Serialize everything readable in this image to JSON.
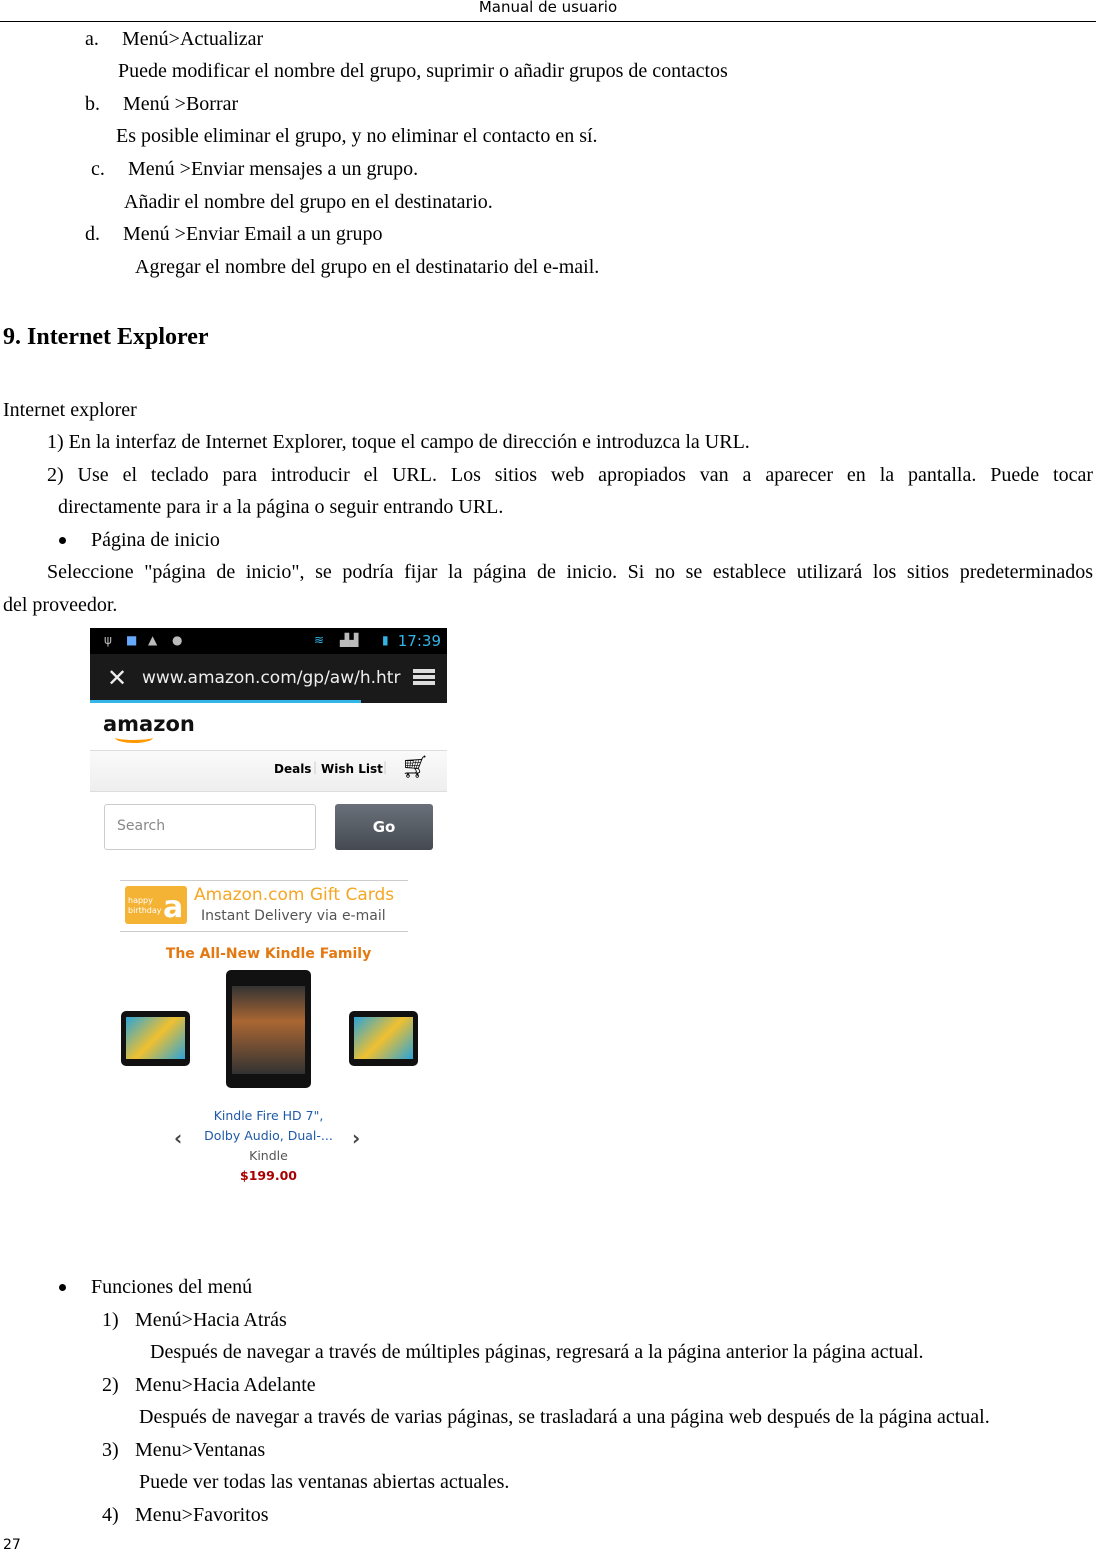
{
  "header": "Manual de usuario",
  "page_number": "27",
  "group_items": [
    {
      "label": "a.",
      "title": "Menú>Actualizar",
      "desc": "Puede modificar el nombre del grupo, suprimir o añadir grupos de contactos"
    },
    {
      "label": "b.",
      "title": "Menú >Borrar",
      "desc": "Es posible eliminar el grupo, y no eliminar el contacto en sí."
    },
    {
      "label": "c.",
      "title": "Menú >Enviar mensajes a un grupo.",
      "desc": "Añadir el nombre del grupo en el destinatario."
    },
    {
      "label": "d.",
      "title": "Menú >Enviar Email a un grupo",
      "desc": "Agregar el nombre del grupo en el destinatario del e-mail."
    }
  ],
  "section_title": "9. Internet Explorer",
  "intro": "Internet explorer",
  "step1": "1) En la interfaz de Internet Explorer, toque el campo de dirección e introduzca la URL.",
  "step2a": "2) Use el teclado para introducir el URL. Los sitios web apropiados van a aparecer en la pantalla. Puede tocar",
  "step2b": "directamente para ir a la página o seguir entrando URL.",
  "bullet1": "Página de inicio",
  "home_a": "Seleccione \"página de inicio\", se podría fijar la página de inicio. Si no se establece utilizará los sitios predeterminados",
  "home_b": "del proveedor.",
  "screenshot": {
    "time": "17:39",
    "url": "www.amazon.com/gp/aw/h.htr",
    "logo": "amazon",
    "nav": [
      "Deals",
      "Wish List"
    ],
    "search_placeholder": "Search",
    "go": "Go",
    "gift_badge": "happy birthday",
    "gift_title_a": "Amazon.com ",
    "gift_title_b": "Gift Cards",
    "gift_sub": "Instant Delivery via e-mail",
    "kindle_heading": "The All-New Kindle Family",
    "product_line1": "Kindle Fire HD 7\",",
    "product_line2": "Dolby Audio, Dual-...",
    "brand": "Kindle",
    "price": "$199.00",
    "progress": 0.76
  },
  "bullet2": "Funciones del menú",
  "menu_items": [
    {
      "num": "1)",
      "title": "Menú>Hacia Atrás",
      "desc": "Después de navegar a través de múltiples páginas, regresará a la página anterior la página actual."
    },
    {
      "num": "2)",
      "title": "Menu>Hacia Adelante",
      "desc": "Después de navegar a través de varias páginas, se trasladará a una página web después de la página actual."
    },
    {
      "num": "3)",
      "title": "Menu>Ventanas",
      "desc": "Puede ver todas las ventanas abiertas actuales."
    },
    {
      "num": "4)",
      "title": "Menu>Favoritos"
    }
  ]
}
